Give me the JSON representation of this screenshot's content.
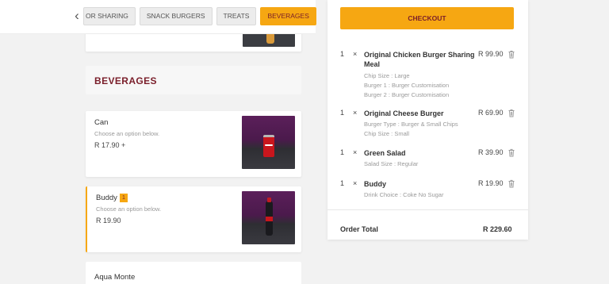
{
  "tabbar": {
    "back_icon": "chevron-left-icon",
    "tabs": [
      {
        "label": "OR SHARING"
      },
      {
        "label": "SNACK BURGERS"
      },
      {
        "label": "TREATS"
      },
      {
        "label": "BEVERAGES",
        "active": true
      }
    ]
  },
  "menu": {
    "section_title": "BEVERAGES",
    "items": [
      {
        "name": "Can",
        "hint": "Choose an option below.",
        "price": "R 17.90 +",
        "image": "coca-cola-can"
      },
      {
        "name": "Buddy",
        "badge": "1",
        "hint": "Choose an option below.",
        "price": "R 19.90",
        "image": "coca-cola-bottle"
      },
      {
        "name": "Aqua Monte"
      }
    ]
  },
  "order": {
    "checkout_label": "CHECKOUT",
    "lines": [
      {
        "qty": "1",
        "x": "×",
        "name": "Original Chicken Burger Sharing Meal",
        "price": "R 99.90",
        "options": [
          "Chip Size : Large",
          "Burger 1 : Burger Customisation",
          "Burger 2 : Burger Customisation"
        ]
      },
      {
        "qty": "1",
        "x": "×",
        "name": "Original Cheese Burger",
        "price": "R 69.90",
        "options": [
          "Burger Type : Burger & Small Chips",
          "Chip Size : Small"
        ]
      },
      {
        "qty": "1",
        "x": "×",
        "name": "Green Salad",
        "price": "R 39.90",
        "options": [
          "Salad Size : Regular"
        ]
      },
      {
        "qty": "1",
        "x": "×",
        "name": "Buddy",
        "price": "R 19.90",
        "options": [
          "Drink Choice : Coke No Sugar"
        ]
      }
    ],
    "total_label": "Order Total",
    "total_value": "R 229.60"
  },
  "colors": {
    "accent": "#f6a712",
    "brand": "#7a1e2a"
  }
}
